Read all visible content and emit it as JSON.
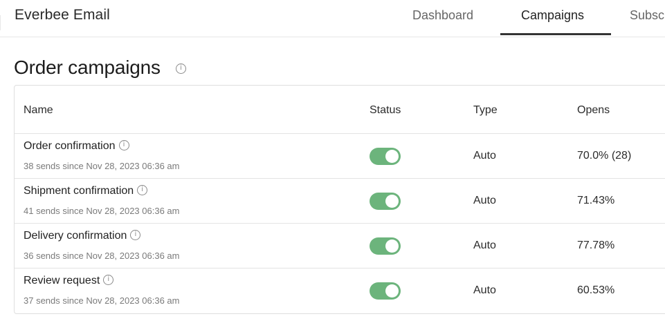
{
  "header": {
    "app_title": "Everbee Email",
    "tabs": [
      {
        "label": "Dashboard",
        "active": false
      },
      {
        "label": "Campaigns",
        "active": true
      },
      {
        "label": "Subsc",
        "active": false
      }
    ]
  },
  "page": {
    "title": "Order campaigns",
    "info_glyph": "i"
  },
  "table": {
    "columns": [
      "Name",
      "Status",
      "Type",
      "Opens"
    ],
    "rows": [
      {
        "name": "Order confirmation",
        "subtitle": "38 sends since Nov 28, 2023 06:36 am",
        "status_on": true,
        "type": "Auto",
        "opens": "70.0% (28)"
      },
      {
        "name": "Shipment confirmation",
        "subtitle": "41 sends since Nov 28, 2023 06:36 am",
        "status_on": true,
        "type": "Auto",
        "opens": "71.43%"
      },
      {
        "name": "Delivery confirmation",
        "subtitle": "36 sends since Nov 28, 2023 06:36 am",
        "status_on": true,
        "type": "Auto",
        "opens": "77.78%"
      },
      {
        "name": "Review request",
        "subtitle": "37 sends since Nov 28, 2023 06:36 am",
        "status_on": true,
        "type": "Auto",
        "opens": "60.53%"
      }
    ]
  },
  "colors": {
    "toggle_on": "#6cb47c",
    "active_tab_underline": "#333333"
  },
  "icons": [
    "info-icon"
  ]
}
